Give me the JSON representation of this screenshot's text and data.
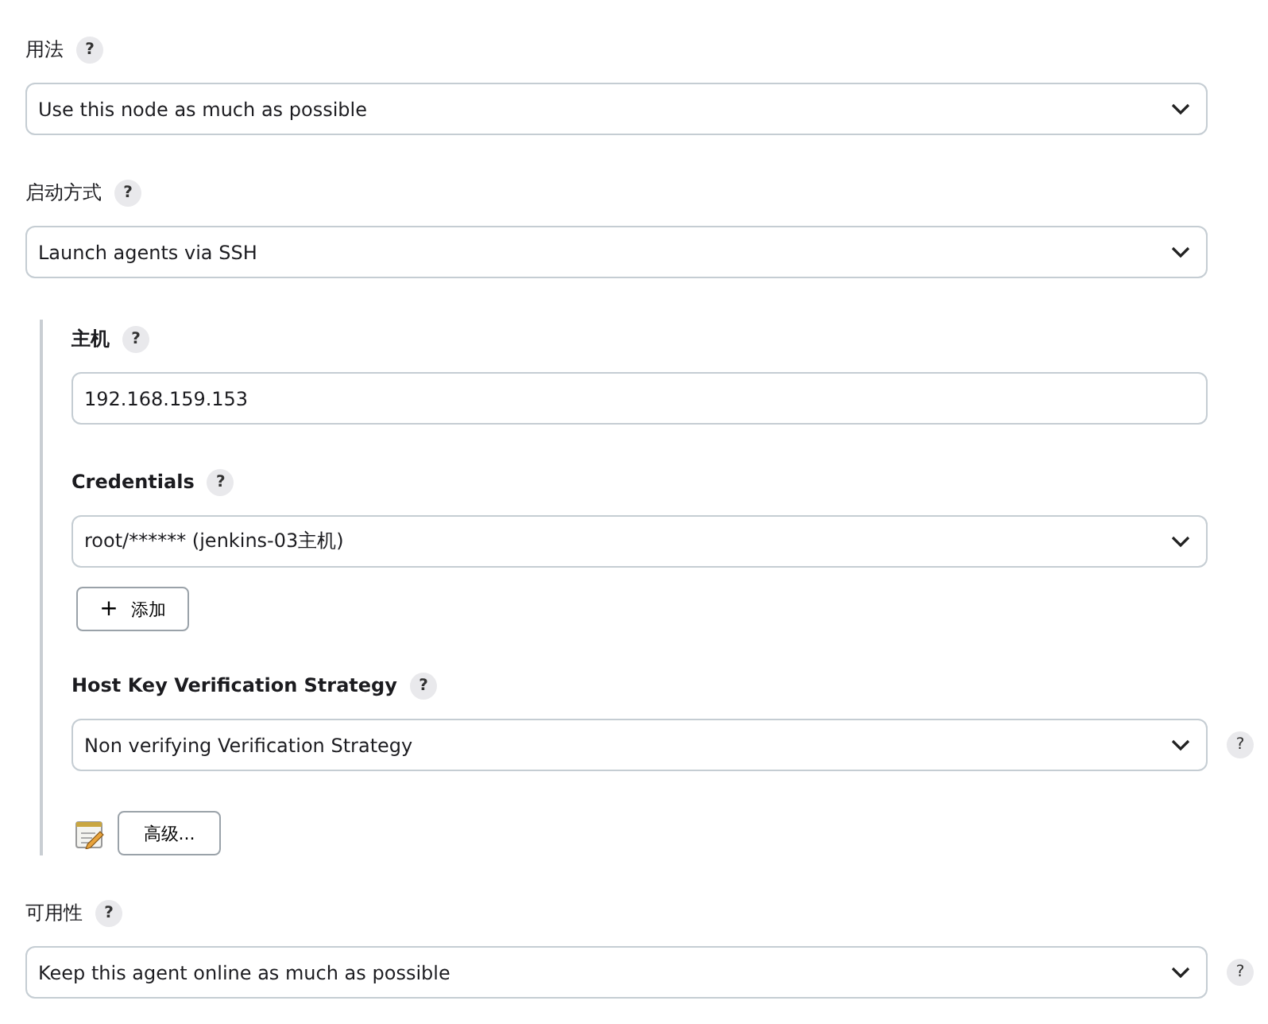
{
  "fields": [
    {
      "kind": "select",
      "label": "用法",
      "help": "?",
      "value": "Use this node as much as possible"
    },
    {
      "kind": "select",
      "label": "启动方式",
      "help": "?",
      "value": "Launch agents via SSH"
    },
    {
      "kind": "group",
      "children": [
        {
          "kind": "text",
          "label": "主机",
          "help": "?",
          "value": "192.168.159.153"
        },
        {
          "kind": "select",
          "label": "Credentials",
          "help": "?",
          "value": "root/****** (jenkins-03主机)",
          "add_button": {
            "icon": "+",
            "label": "添加"
          }
        },
        {
          "kind": "select",
          "label": "Host Key Verification Strategy",
          "help": "?",
          "value": "Non verifying Verification Strategy",
          "side_help": "?"
        },
        {
          "kind": "advanced",
          "label": "高级..."
        }
      ]
    },
    {
      "kind": "select",
      "label": "可用性",
      "help": "?",
      "value": "Keep this agent online as much as possible",
      "side_help": "?"
    }
  ]
}
